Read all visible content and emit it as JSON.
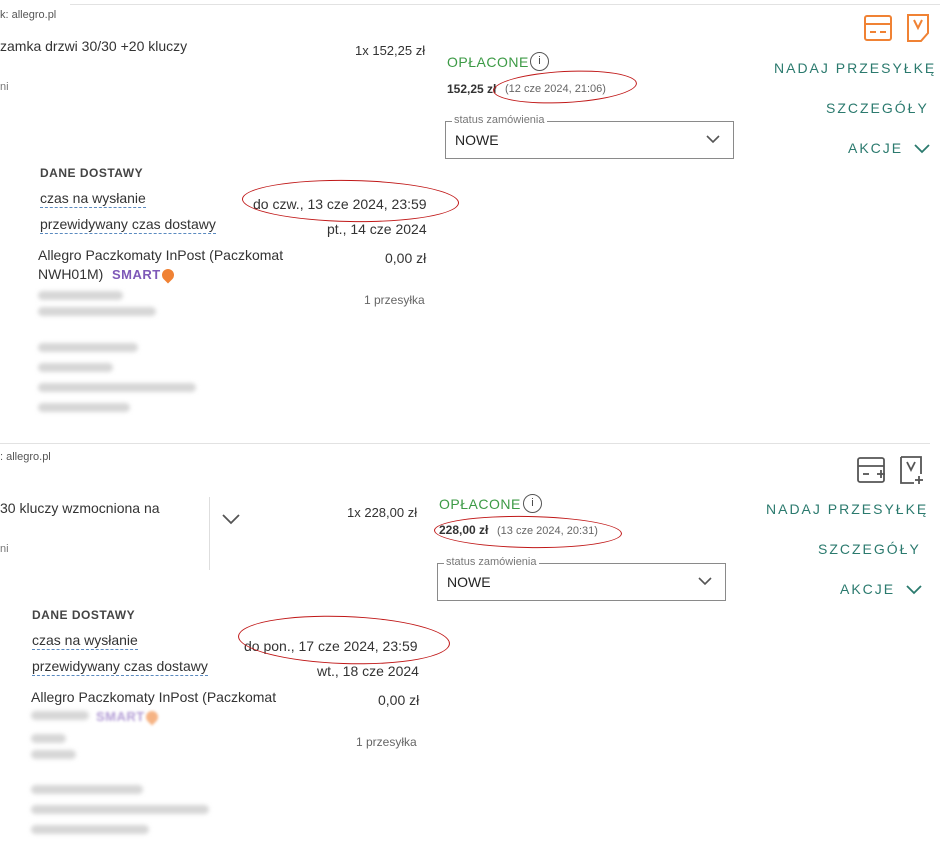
{
  "order1": {
    "source": "k: allegro.pl",
    "title": "zamka drzwi 30/30 +20 kluczy",
    "sub": "ni",
    "quantity_price": "1x 152,25 zł",
    "paid_label": "OPŁACONE",
    "info_label": "i",
    "amount": "152,25 zł",
    "date": "(12 cze 2024, 21:06)",
    "status_legend": "status zamówienia",
    "status_value": "NOWE",
    "actions": {
      "ship": "NADAJ PRZESYŁKĘ",
      "details": "SZCZEGÓŁY",
      "more": "AKCJE"
    },
    "delivery": {
      "title": "DANE DOSTAWY",
      "send_label": "czas na wysłanie",
      "send_value": "do czw., 13 cze 2024, 23:59",
      "expected_label": "przewidywany czas dostawy",
      "expected_value": "pt., 14 cze 2024",
      "method": "Allegro Paczkomaty InPost (Paczkomat",
      "method_code": "NWH01M)",
      "smart": "SMART",
      "method_price": "0,00 zł",
      "parcels": "1 przesyłka"
    },
    "icon_colors": {
      "primary": "#f08234"
    }
  },
  "order2": {
    "source": ": allegro.pl",
    "title": "30 kluczy wzmocniona na",
    "sub": "ni",
    "quantity_price": "1x 228,00 zł",
    "paid_label": "OPŁACONE",
    "info_label": "i",
    "amount": "228,00 zł",
    "date": "(13 cze 2024, 20:31)",
    "status_legend": "status zamówienia",
    "status_value": "NOWE",
    "actions": {
      "ship": "NADAJ PRZESYŁKĘ",
      "details": "SZCZEGÓŁY",
      "more": "AKCJE"
    },
    "delivery": {
      "title": "DANE DOSTAWY",
      "send_label": "czas na wysłanie",
      "send_value": "do pon., 17 cze 2024, 23:59",
      "expected_label": "przewidywany czas dostawy",
      "expected_value": "wt., 18 cze 2024",
      "method": "Allegro Paczkomaty InPost (Paczkomat",
      "smart": "SMART",
      "method_price": "0,00 zł",
      "parcels": "1 przesyłka"
    },
    "icon_colors": {
      "primary": "#555555"
    }
  },
  "colors": {
    "paid": "#3c9a45",
    "action": "#2b7a6e",
    "annotation": "#c01818",
    "smart": "#7e59b8"
  }
}
